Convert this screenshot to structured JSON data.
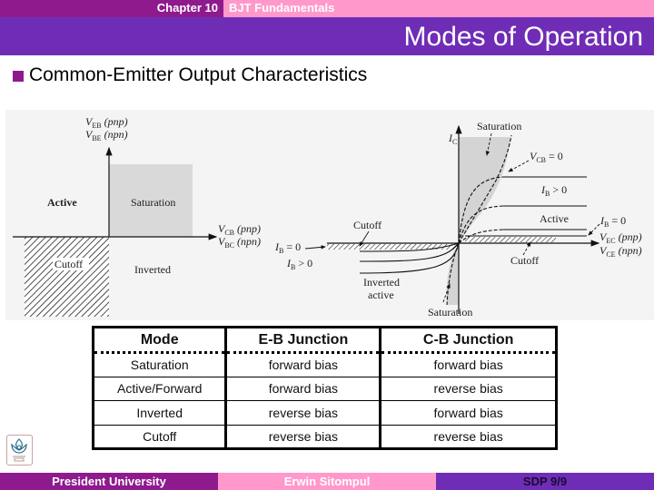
{
  "header": {
    "chapter": "Chapter 10",
    "topic": "BJT Fundamentals",
    "title": "Modes of Operation"
  },
  "bullet": {
    "text": "Common-Emitter Output Characteristics"
  },
  "figure": {
    "left_diagram": {
      "y_axis_label_1": "V",
      "y_axis_sub_1": "EB",
      "y_axis_suffix_1": "(pnp)",
      "y_axis_label_2": "V",
      "y_axis_sub_2": "BE",
      "y_axis_suffix_2": "(npn)",
      "x_axis_label_1": "V",
      "x_axis_sub_1": "CB",
      "x_axis_suffix_1": "(pnp)",
      "x_axis_label_2": "V",
      "x_axis_sub_2": "BC",
      "x_axis_suffix_2": "(npn)",
      "regions": {
        "active": "Active",
        "saturation": "Saturation",
        "cutoff": "Cutoff",
        "inverted": "Inverted"
      }
    },
    "right_diagram": {
      "y_axis_label": "I",
      "y_axis_sub": "C",
      "x_axis_label_1": "V",
      "x_axis_sub_1": "EC",
      "x_axis_suffix_1": "(pnp)",
      "x_axis_label_2": "V",
      "x_axis_sub_2": "CE",
      "x_axis_suffix_2": "(npn)",
      "labels": {
        "saturation_top": "Saturation",
        "saturation_bottom": "Saturation",
        "vcb_zero": "V",
        "vcb_zero_sub": "CB",
        "vcb_zero_eq": " = 0",
        "ib_pos_right": "I",
        "ib_pos_right_sub": "B",
        "ib_pos_right_eq": " > 0",
        "active": "Active",
        "ib_zero_right": "I",
        "ib_zero_right_sub": "B",
        "ib_zero_right_eq": " = 0",
        "cutoff_right": "Cutoff",
        "cutoff_left": "Cutoff",
        "ib_zero_left": "I",
        "ib_zero_left_sub": "B",
        "ib_zero_left_eq": " = 0",
        "ib_pos_left": "I",
        "ib_pos_left_sub": "B",
        "ib_pos_left_eq": " > 0",
        "inverted_active_1": "Inverted",
        "inverted_active_2": "active"
      }
    }
  },
  "table": {
    "headers": [
      "Mode",
      "E-B Junction",
      "C-B Junction"
    ],
    "rows": [
      [
        "Saturation",
        "forward bias",
        "forward bias"
      ],
      [
        "Active/Forward",
        "forward bias",
        "reverse bias"
      ],
      [
        "Inverted",
        "reverse bias",
        "forward bias"
      ],
      [
        "Cutoff",
        "reverse bias",
        "reverse bias"
      ]
    ]
  },
  "footer": {
    "institution": "President University",
    "author": "Erwin Sitompul",
    "page": "SDP 9/9"
  },
  "colors": {
    "purple_dark": "#8e1a8e",
    "purple_band": "#6f2db6",
    "pink": "#ff99cc"
  },
  "icons": {
    "bullet": "square-bullet-icon",
    "logo": "university-logo-icon"
  }
}
